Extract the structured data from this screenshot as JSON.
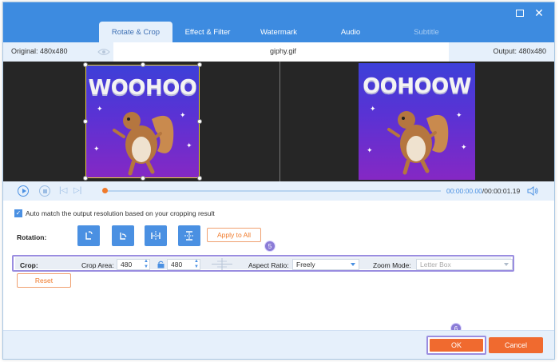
{
  "tabs": [
    {
      "label": "Rotate & Crop",
      "active": true
    },
    {
      "label": "Effect & Filter",
      "active": false
    },
    {
      "label": "Watermark",
      "active": false
    },
    {
      "label": "Audio",
      "active": false
    },
    {
      "label": "Subtitle",
      "active": false,
      "disabled": true
    }
  ],
  "infobar": {
    "original": "Original: 480x480",
    "filename": "giphy.gif",
    "output": "Output: 480x480"
  },
  "preview": {
    "left_image_text": "WOOHOO",
    "right_image_text": "OOHOOW"
  },
  "playback": {
    "current_time": "00:00:00.00",
    "total_time": "/00:00:01.19",
    "progress": 0
  },
  "settings": {
    "auto_match_label": "Auto match the output resolution based on your cropping result",
    "auto_match_checked": true,
    "rotation_label": "Rotation:",
    "rotation_buttons": [
      "rotate-left-icon",
      "rotate-right-icon",
      "flip-horizontal-icon",
      "flip-vertical-icon"
    ],
    "apply_all_label": "Apply to All",
    "crop_label": "Crop:",
    "crop_area_label": "Crop Area:",
    "crop_width": "480",
    "crop_height": "480",
    "aspect_ratio_label": "Aspect Ratio:",
    "aspect_ratio_value": "Freely",
    "zoom_mode_label": "Zoom Mode:",
    "zoom_mode_value": "Letter Box",
    "reset_label": "Reset"
  },
  "badges": {
    "crop_step": "5",
    "ok_step": "6"
  },
  "footer": {
    "ok_label": "OK",
    "cancel_label": "Cancel"
  },
  "colors": {
    "accent_blue": "#3d8be0",
    "accent_orange": "#f06a2f",
    "highlight_purple": "#9a8de0"
  }
}
